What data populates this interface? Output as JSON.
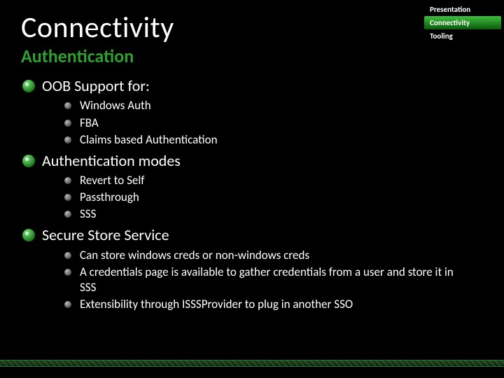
{
  "title": "Connectivity",
  "subtitle": "Authentication",
  "nav": {
    "items": [
      {
        "label": "Presentation",
        "active": false
      },
      {
        "label": "Connectivity",
        "active": true
      },
      {
        "label": "Tooling",
        "active": false
      }
    ]
  },
  "sections": [
    {
      "heading": "OOB Support for:",
      "items": [
        "Windows  Auth",
        "FBA",
        "Claims based Authentication"
      ]
    },
    {
      "heading": "Authentication modes",
      "items": [
        "Revert to Self",
        "Passthrough",
        "SSS"
      ]
    },
    {
      "heading": "Secure Store Service",
      "items": [
        "Can store windows creds or non-windows creds",
        "A credentials page is available to gather credentials from a user and store it in SSS",
        "Extensibility through ISSSProvider to plug in another SSO"
      ]
    }
  ]
}
